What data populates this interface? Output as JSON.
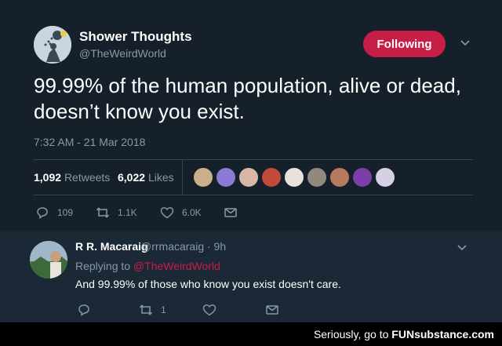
{
  "tweet": {
    "author_name": "Shower Thoughts",
    "author_handle": "@TheWeirdWorld",
    "follow_label": "Following",
    "text": "99.99% of the human population, alive or dead, doesn’t know you exist.",
    "timestamp": "7:32 AM - 21 Mar 2018",
    "retweets_count": "1,092",
    "retweets_label": "Retweets",
    "likes_count": "6,022",
    "likes_label": "Likes",
    "liker_avatar_colors": [
      "#c9b08a",
      "#8a7bd6",
      "#d9b7a5",
      "#c24a3a",
      "#e7e2dc",
      "#8f8a7c",
      "#b77a5e",
      "#7a3fa8",
      "#d6d0e4"
    ],
    "actions": {
      "reply_count": "109",
      "retweet_count": "1.1K",
      "like_count": "6.0K"
    }
  },
  "reply": {
    "author_name": "R R. Macaraig",
    "author_meta": "@rrmacaraig · 9h",
    "replying_prefix": "Replying to",
    "replying_handle": "@TheWeirdWorld",
    "text": "And 99.99% of those who know you exist doesn't care.",
    "retweet_count": "1"
  },
  "footer": {
    "text": "Seriously, go to",
    "brand": "FUNsubstance.com"
  },
  "colors": {
    "background": "#15202b",
    "accent": "#c81d47",
    "muted": "#8899a6"
  }
}
